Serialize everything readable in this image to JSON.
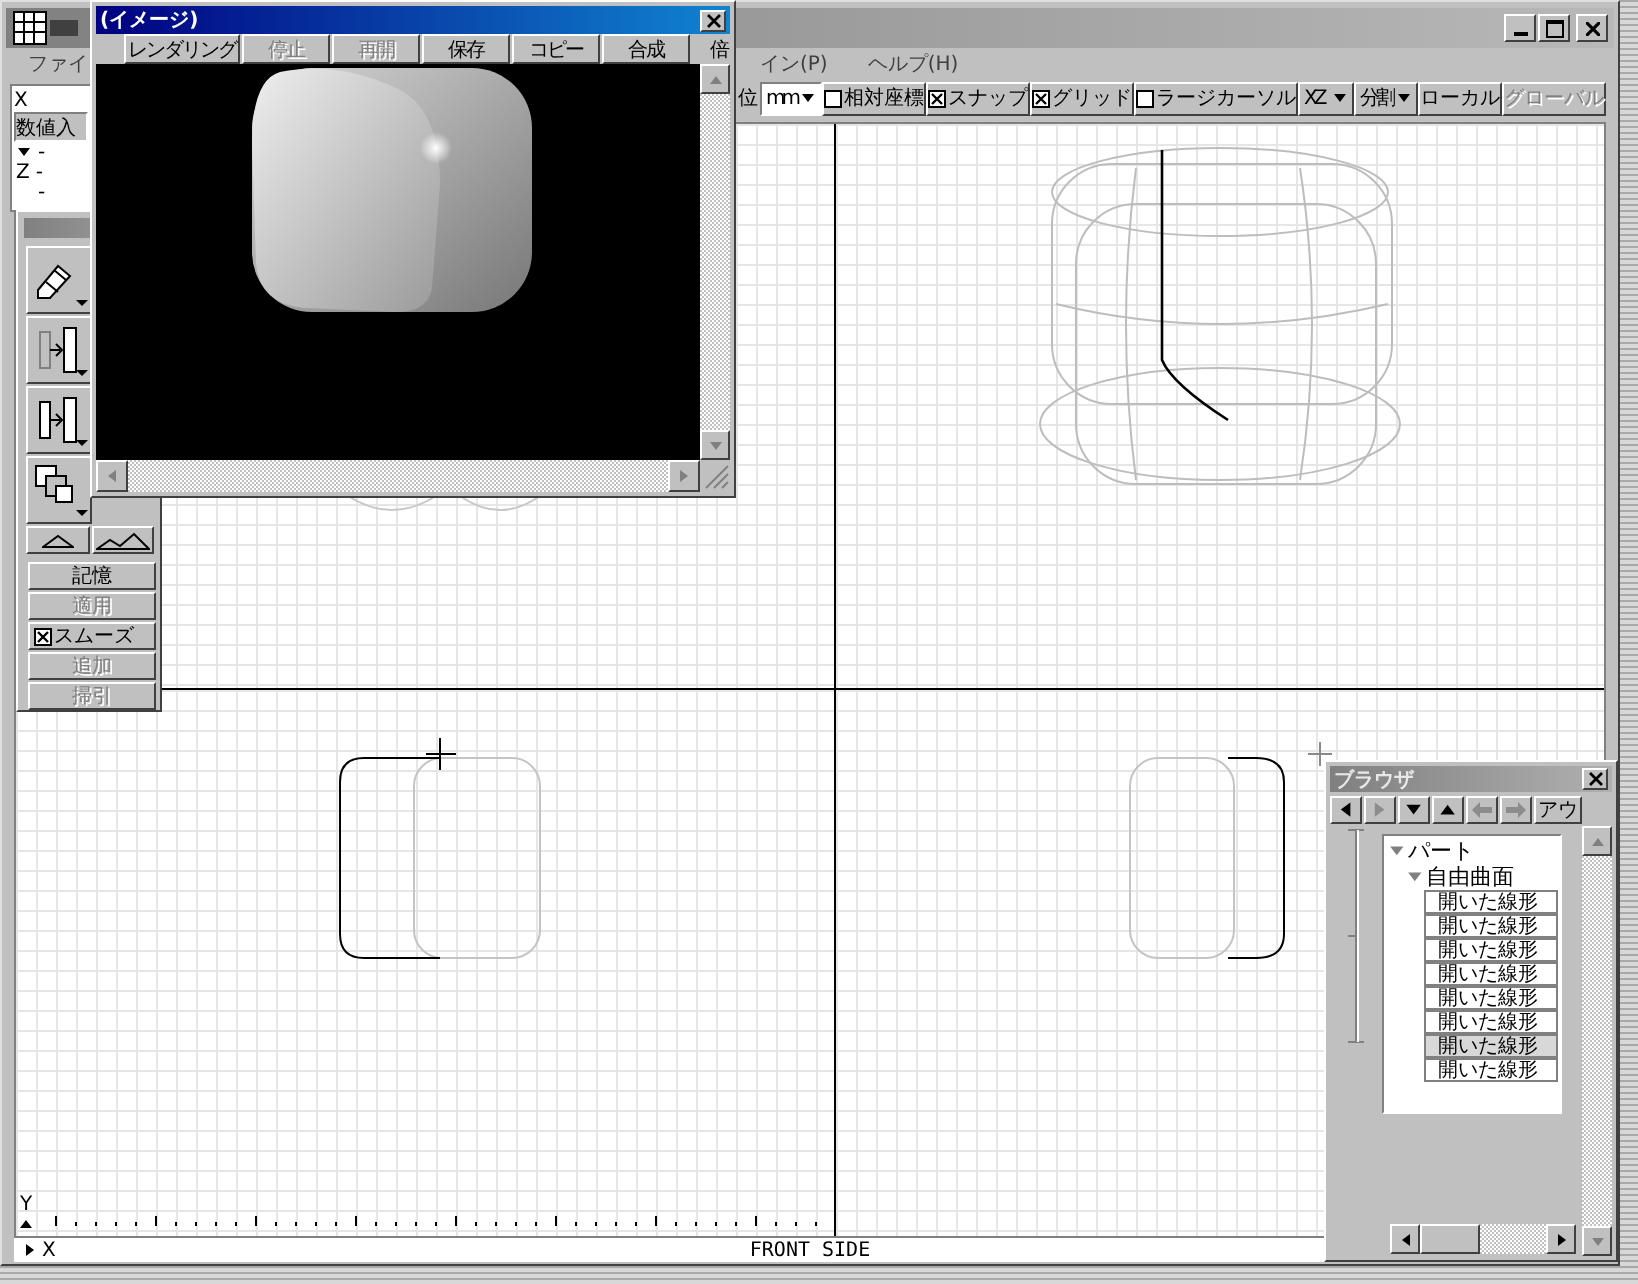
{
  "menu": [
    {
      "label": "ファイ"
    },
    {
      "label": "イン(P)"
    },
    {
      "label": "ヘルプ(H)"
    }
  ],
  "toolbar": {
    "unit_label": "位",
    "unit": "mm",
    "checks": [
      {
        "label": "相対座標",
        "checked": false
      },
      {
        "label": "スナップ",
        "checked": true
      },
      {
        "label": "グリッド",
        "checked": true
      },
      {
        "label": "ラージカーソル",
        "checked": false
      }
    ],
    "plane": "XZ",
    "split": "分割",
    "buttons": [
      {
        "label": "ローカル",
        "disabled": false
      },
      {
        "label": "グローバル",
        "disabled": true
      }
    ]
  },
  "coord_panel": {
    "x_label": "X",
    "input_label": "数値入",
    "rows": [
      {
        "kind": "marker",
        "value": "-"
      },
      {
        "kind": "axis",
        "label": "Z",
        "value": "-"
      },
      {
        "kind": "plain",
        "value": "-"
      }
    ]
  },
  "tools": {
    "items": [
      {
        "kind": "button",
        "label": "記憶",
        "disabled": false
      },
      {
        "kind": "button",
        "label": "適用",
        "disabled": true
      },
      {
        "kind": "check",
        "label": "スムーズ",
        "checked": true
      },
      {
        "kind": "button",
        "label": "追加",
        "disabled": true
      },
      {
        "kind": "button",
        "label": "掃引",
        "disabled": true
      }
    ]
  },
  "viewports": {
    "axis_y": "Y",
    "axis_x": "X",
    "view_label": "FRONT SIDE"
  },
  "image_window": {
    "title": "(イメージ)",
    "buttons": [
      {
        "label": "レンダリング",
        "disabled": false
      },
      {
        "label": "停止",
        "disabled": true
      },
      {
        "label": "再開",
        "disabled": true
      },
      {
        "label": "保存",
        "disabled": false
      },
      {
        "label": "コピー",
        "disabled": false
      },
      {
        "label": "合成",
        "disabled": false
      }
    ],
    "cut_label": "倍"
  },
  "browser": {
    "title": "ブラウザ",
    "nav": [
      {
        "kind": "left",
        "disabled": false
      },
      {
        "kind": "right",
        "disabled": true
      },
      {
        "kind": "down",
        "disabled": false
      },
      {
        "kind": "up",
        "disabled": false
      },
      {
        "kind": "back",
        "disabled": true
      },
      {
        "kind": "forward",
        "disabled": true
      }
    ],
    "nav_label": "アウ",
    "tree": [
      {
        "label": "パート",
        "expanded": true,
        "children": [
          {
            "label": "自由曲面",
            "expanded": true,
            "children": [
              {
                "label": "開いた線形",
                "selected": false
              },
              {
                "label": "開いた線形",
                "selected": false
              },
              {
                "label": "開いた線形",
                "selected": false
              },
              {
                "label": "開いた線形",
                "selected": false
              },
              {
                "label": "開いた線形",
                "selected": false
              },
              {
                "label": "開いた線形",
                "selected": false
              },
              {
                "label": "開いた線形",
                "selected": true
              },
              {
                "label": "開いた線形",
                "selected": false
              }
            ]
          }
        ]
      }
    ]
  }
}
